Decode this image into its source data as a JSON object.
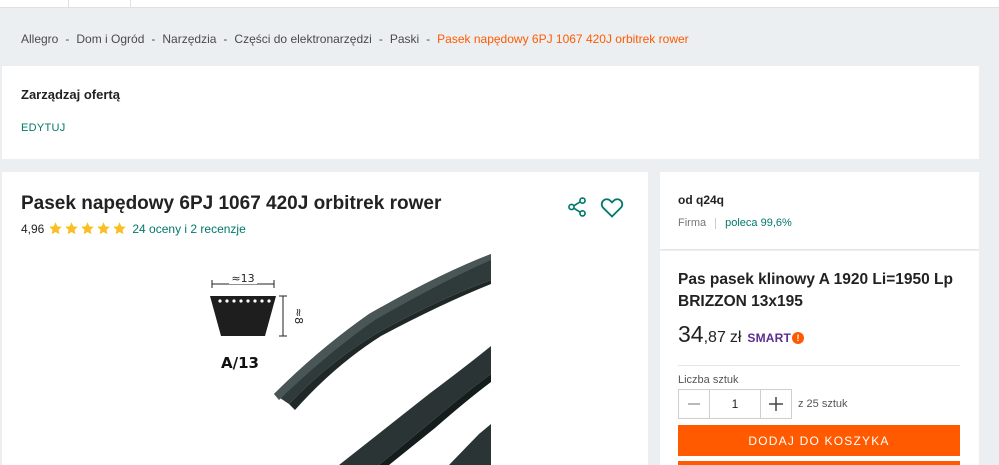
{
  "breadcrumb": {
    "items": [
      "Allegro",
      "Dom i Ogród",
      "Narzędzia",
      "Części do elektronarzędzi",
      "Paski"
    ],
    "current": "Pasek napędowy 6PJ 1067 420J orbitrek rower",
    "separator": "-"
  },
  "manage": {
    "title": "Zarządzaj ofertą",
    "edit_label": "EDYTUJ"
  },
  "product": {
    "title": "Pasek napędowy 6PJ 1067 420J orbitrek rower",
    "rating_value": "4,96",
    "stars": 5,
    "reviews_text": "24 oceny i 2 recenzje",
    "image_labels": {
      "width": "≈13",
      "height": "≈8",
      "profile": "A/13"
    }
  },
  "seller": {
    "name": "od q24q",
    "type": "Firma",
    "recommend": "poleca 99,6%"
  },
  "offer": {
    "title": "Pas pasek klinowy A 1920 Li=1950 Lp BRIZZON 13x195",
    "price_main": "34",
    "price_cents": ",87",
    "currency": "zł",
    "smart_label": "SMART",
    "quantity_label": "Liczba sztuk",
    "quantity_value": "1",
    "quantity_max": "z 25 sztuk",
    "add_to_cart_label": "DODAJ DO KOSZYKA"
  },
  "colors": {
    "accent": "#ff5a00",
    "link": "#00796b",
    "star": "#fbbf24",
    "smart": "#5c2d91"
  }
}
